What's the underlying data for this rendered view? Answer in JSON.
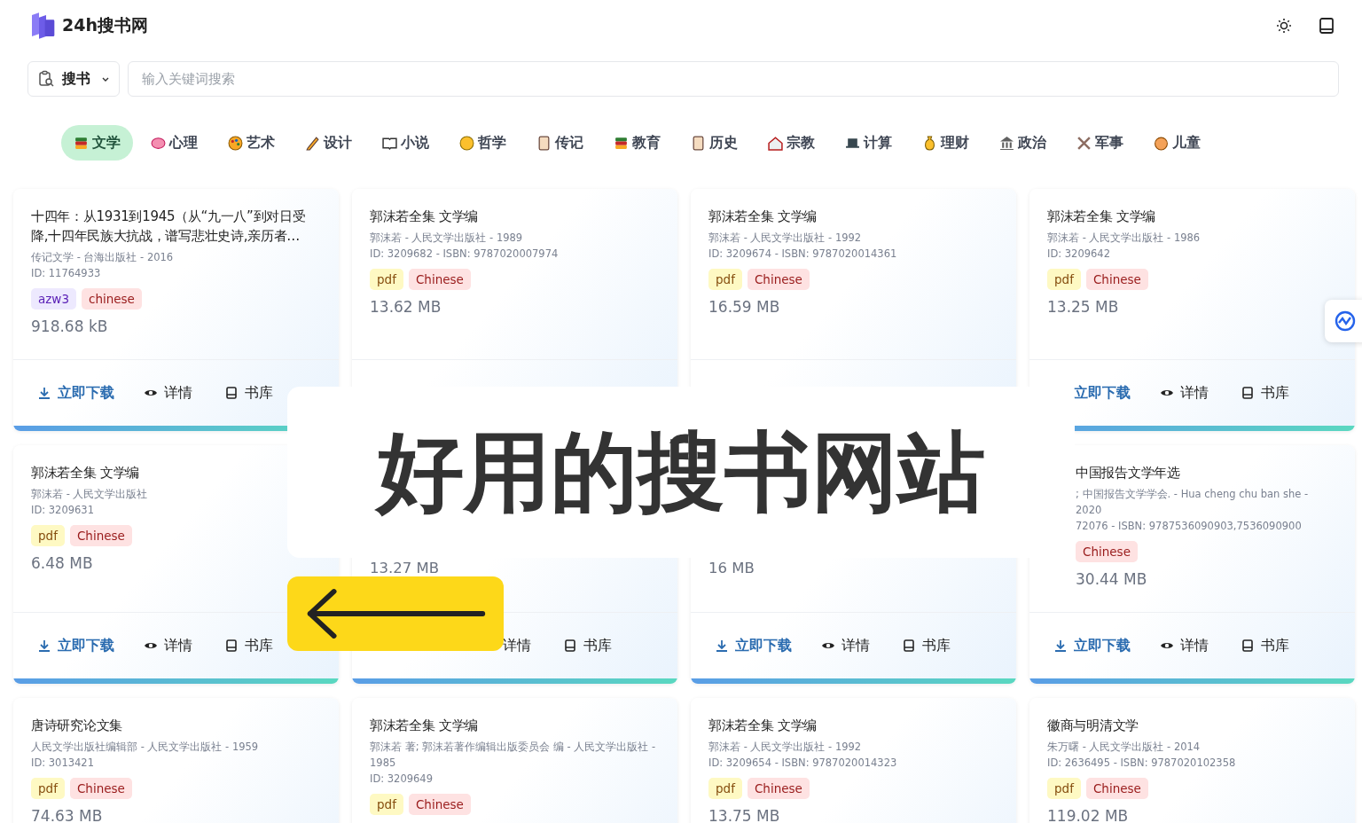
{
  "site": {
    "title": "24h搜书网"
  },
  "search": {
    "mode": "搜书",
    "placeholder": "输入关键词搜索"
  },
  "categories": [
    {
      "label": "文学",
      "selected": true
    },
    {
      "label": "心理",
      "selected": false
    },
    {
      "label": "艺术",
      "selected": false
    },
    {
      "label": "设计",
      "selected": false
    },
    {
      "label": "小说",
      "selected": false
    },
    {
      "label": "哲学",
      "selected": false
    },
    {
      "label": "传记",
      "selected": false
    },
    {
      "label": "教育",
      "selected": false
    },
    {
      "label": "历史",
      "selected": false
    },
    {
      "label": "宗教",
      "selected": false
    },
    {
      "label": "计算",
      "selected": false
    },
    {
      "label": "理财",
      "selected": false
    },
    {
      "label": "政治",
      "selected": false
    },
    {
      "label": "军事",
      "selected": false
    },
    {
      "label": "儿童",
      "selected": false
    }
  ],
  "cards": [
    {
      "title": "十四年：从1931到1945（从“九一八”到对日受降,十四年民族大抗战，谱写悲壮史诗,亲历者…",
      "meta": [
        "传记文学 - 台海出版社 - 2016",
        "ID: 11764933"
      ],
      "tags": [
        {
          "text": "azw3",
          "color": "#ede9fe"
        },
        {
          "text": "chinese",
          "color": "#fee2e2"
        }
      ],
      "size": "918.68 kB",
      "actions": [
        {
          "kind": "download",
          "label": "立即下载",
          "show_icon": true
        },
        {
          "kind": "details",
          "label": "详情",
          "show_icon": true
        },
        {
          "kind": "library",
          "label": "书库",
          "show_icon": true
        }
      ]
    },
    {
      "title": "郭沫若全集 文学编",
      "meta": [
        "郭沫若 - 人民文学出版社 - 1989",
        "ID: 3209682 - ISBN: 9787020007974"
      ],
      "tags": [
        {
          "text": "pdf",
          "color": "#fef9c3"
        },
        {
          "text": "Chinese",
          "color": "#fee2e2"
        }
      ],
      "size": "13.62 MB"
    },
    {
      "title": "郭沫若全集 文学编",
      "meta": [
        "郭沫若 - 人民文学出版社 - 1992",
        "ID: 3209674 - ISBN: 9787020014361"
      ],
      "tags": [
        {
          "text": "pdf",
          "color": "#fef9c3"
        },
        {
          "text": "Chinese",
          "color": "#fee2e2"
        }
      ],
      "size": "16.59 MB"
    },
    {
      "title": "郭沫若全集 文学编",
      "meta": [
        "郭沫若 - 人民文学出版社 - 1986",
        "ID: 3209642"
      ],
      "tags": [
        {
          "text": "pdf",
          "color": "#fef9c3"
        },
        {
          "text": "Chinese",
          "color": "#fee2e2"
        }
      ],
      "size": "13.25 MB",
      "actions": [
        {
          "kind": "download",
          "label": "立即下载",
          "show_icon": false
        },
        {
          "kind": "details",
          "label": "详情",
          "show_icon": true
        },
        {
          "kind": "library",
          "label": "书库",
          "show_icon": true
        }
      ]
    },
    {
      "title": "郭沫若全集 文学编",
      "meta": [
        "郭沫若 - 人民文学出版社",
        "ID: 3209631"
      ],
      "tags": [
        {
          "text": "pdf",
          "color": "#fef9c3"
        },
        {
          "text": "Chinese",
          "color": "#fee2e2"
        }
      ],
      "size": "6.48 MB",
      "actions": [
        {
          "kind": "download",
          "label": "立即下载",
          "show_icon": true
        },
        {
          "kind": "details",
          "label": "详情",
          "show_icon": true
        },
        {
          "kind": "library",
          "label": "书库",
          "show_icon": true
        }
      ]
    },
    {
      "size": "13.27 MB",
      "actions": [
        {
          "kind": "details",
          "label": "详情",
          "show_icon": false
        },
        {
          "kind": "library",
          "label": "书库",
          "show_icon": true
        }
      ]
    },
    {
      "size": "16 MB",
      "actions": [
        {
          "kind": "download",
          "label": "立即下载",
          "show_icon": true
        },
        {
          "kind": "details",
          "label": "详情",
          "show_icon": true
        },
        {
          "kind": "library",
          "label": "书库",
          "show_icon": true
        }
      ]
    },
    {
      "title": "中国报告文学年选",
      "meta": [
        "; 中国报告文学学会. - Hua cheng chu ban she - 2020",
        "72076 - ISBN: 9787536090903,7536090900"
      ],
      "tags": [
        {
          "text": "Chinese",
          "color": "#fee2e2"
        }
      ],
      "size": "30.44 MB",
      "actions": [
        {
          "kind": "download",
          "label": "立即下载",
          "show_icon": true
        },
        {
          "kind": "details",
          "label": "详情",
          "show_icon": true
        },
        {
          "kind": "library",
          "label": "书库",
          "show_icon": true
        }
      ]
    },
    {
      "title": "唐诗研究论文集",
      "meta": [
        "人民文学出版社编辑部 - 人民文学出版社 - 1959",
        "ID: 3013421"
      ],
      "tags": [
        {
          "text": "pdf",
          "color": "#fef9c3"
        },
        {
          "text": "Chinese",
          "color": "#fee2e2"
        }
      ],
      "size": "74.63 MB"
    },
    {
      "title": "郭沫若全集 文学编",
      "meta": [
        "郭沫若 著; 郭沫若著作编辑出版委员会 编 - 人民文学出版社 - 1985",
        "ID: 3209649"
      ],
      "tags": [
        {
          "text": "pdf",
          "color": "#fef9c3"
        },
        {
          "text": "Chinese",
          "color": "#fee2e2"
        }
      ]
    },
    {
      "title": "郭沫若全集 文学编",
      "meta": [
        "郭沫若 - 人民文学出版社 - 1992",
        "ID: 3209654 - ISBN: 9787020014323"
      ],
      "tags": [
        {
          "text": "pdf",
          "color": "#fef9c3"
        },
        {
          "text": "Chinese",
          "color": "#fee2e2"
        }
      ],
      "size": "13.75 MB"
    },
    {
      "title": "徽商与明清文学",
      "meta": [
        "朱万曙 - 人民文学出版社 - 2014",
        "ID: 2636495 - ISBN: 9787020102358"
      ],
      "tags": [
        {
          "text": "pdf",
          "color": "#fef9c3"
        },
        {
          "text": "Chinese",
          "color": "#fee2e2"
        }
      ],
      "size": "119.02 MB"
    }
  ],
  "banner": {
    "text": "好用的搜书网站"
  }
}
